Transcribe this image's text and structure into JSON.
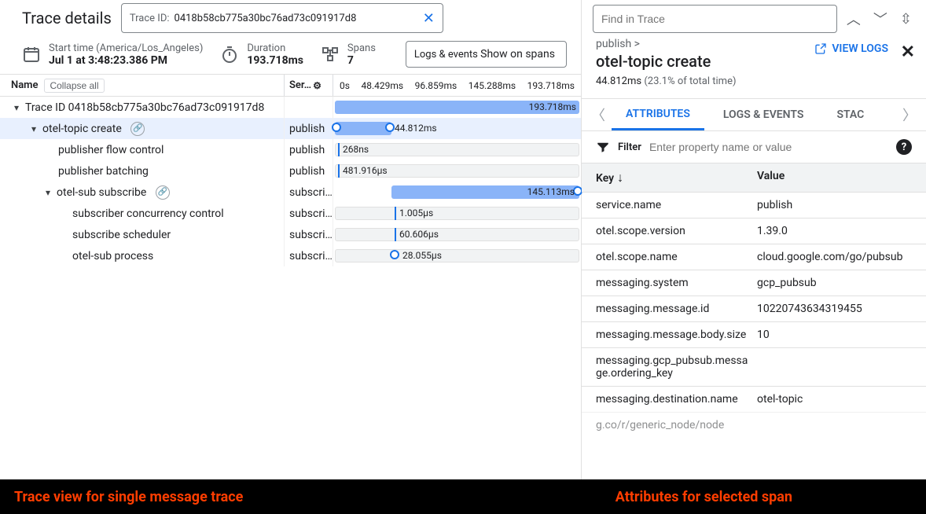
{
  "header": {
    "title": "Trace details",
    "trace_id_label": "Trace ID:",
    "trace_id_value": "0418b58cb775a30bc76ad73c091917d8"
  },
  "meta": {
    "start_label": "Start time (America/Los_Angeles)",
    "start_value": "Jul 1 at 3:48:23.386 PM",
    "duration_label": "Duration",
    "duration_value": "193.718ms",
    "spans_label": "Spans",
    "spans_value": "7",
    "logs_legend": "Logs & events",
    "logs_value": "Show on spans"
  },
  "table_hdr": {
    "name": "Name",
    "collapse": "Collapse all",
    "service": "Ser…",
    "ticks": [
      "0s",
      "48.429ms",
      "96.859ms",
      "145.288ms",
      "193.718ms"
    ]
  },
  "spans": {
    "root": {
      "name": "Trace ID 0418b58cb775a30bc76ad73c091917d8",
      "svc": "",
      "bar_label": "193.718ms"
    },
    "s1": {
      "name": "otel-topic create",
      "svc": "publish",
      "bar_label": "44.812ms"
    },
    "s2": {
      "name": "publisher flow control",
      "svc": "publish",
      "bar_label": "268ns"
    },
    "s3": {
      "name": "publisher batching",
      "svc": "publish",
      "bar_label": "481.916µs"
    },
    "s4": {
      "name": "otel-sub subscribe",
      "svc": "subscri…",
      "bar_label": "145.113ms"
    },
    "s5": {
      "name": "subscriber concurrency control",
      "svc": "subscri…",
      "bar_label": "1.005µs"
    },
    "s6": {
      "name": "subscribe scheduler",
      "svc": "subscri…",
      "bar_label": "60.606µs"
    },
    "s7": {
      "name": "otel-sub process",
      "svc": "subscri…",
      "bar_label": "28.055µs"
    }
  },
  "right": {
    "search_placeholder": "Find in Trace",
    "breadcrumb": "publish >",
    "title": "otel-topic create",
    "dur": "44.812ms",
    "pct": "(23.1% of total time)",
    "view_logs": "VIEW LOGS",
    "tabs": {
      "attributes": "ATTRIBUTES",
      "logs": "LOGS & EVENTS",
      "stack": "STAC"
    },
    "filter_label": "Filter",
    "filter_placeholder": "Enter property name or value",
    "attr_hdr_key": "Key",
    "attr_hdr_value": "Value",
    "attrs": [
      {
        "k": "service.name",
        "v": "publish"
      },
      {
        "k": "otel.scope.version",
        "v": "1.39.0"
      },
      {
        "k": "otel.scope.name",
        "v": "cloud.google.com/go/pubsub"
      },
      {
        "k": "messaging.system",
        "v": "gcp_pubsub"
      },
      {
        "k": "messaging.message.id",
        "v": "10220743634319455"
      },
      {
        "k": "messaging.message.body.size",
        "v": "10"
      },
      {
        "k": "messaging.gcp_pubsub.message.ordering_key",
        "v": ""
      },
      {
        "k": "messaging.destination.name",
        "v": "otel-topic"
      },
      {
        "k": "g.co/r/generic_node/node",
        "v": ""
      }
    ]
  },
  "captions": {
    "left": "Trace view for single message trace",
    "right": "Attributes for selected span"
  }
}
